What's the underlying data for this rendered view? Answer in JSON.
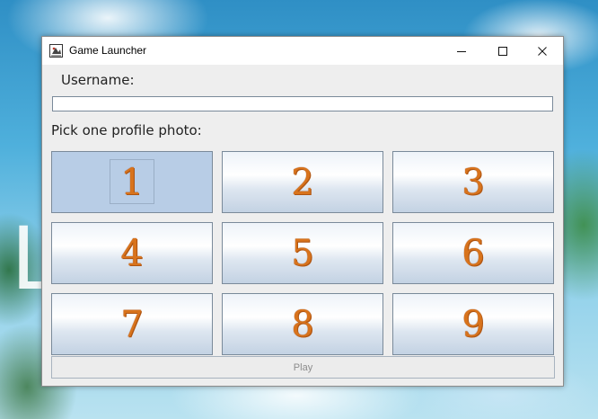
{
  "window": {
    "title": "Game Launcher",
    "icon": "java-app-icon",
    "controls": [
      "minimize-icon",
      "maximize-icon",
      "close-icon"
    ]
  },
  "form": {
    "username_label": "Username:",
    "username_value": "",
    "pick_label": "Pick one profile photo:",
    "photos": [
      "1",
      "2",
      "3",
      "4",
      "5",
      "6",
      "7",
      "8",
      "9"
    ],
    "selected_photo": "1",
    "play_label": "Play",
    "play_enabled": false
  },
  "desktop": {
    "partial_glyph": "L"
  },
  "colors": {
    "number_orange": "#d8731c",
    "selected_bg": "#b8cde6",
    "disabled_text": "#8c8c8c"
  }
}
